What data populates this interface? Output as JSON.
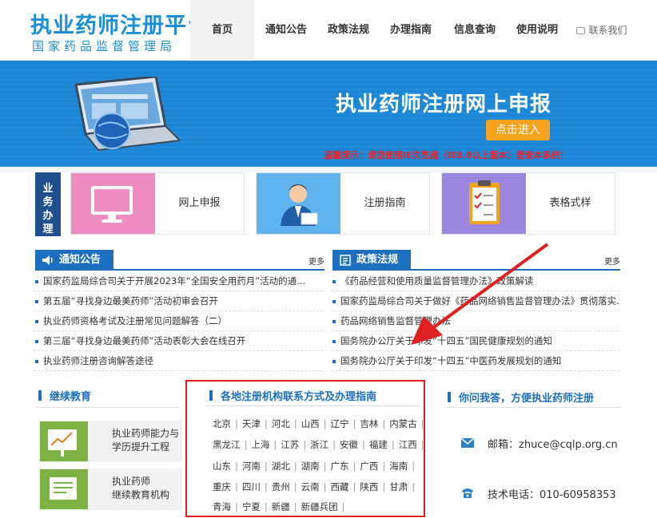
{
  "header": {
    "title": "执业药师注册平台",
    "subtitle": "国家药品监督管理局",
    "nav": [
      "首页",
      "通知公告",
      "政策法规",
      "办理指南",
      "信息查询",
      "使用说明"
    ],
    "contact": "联系我们"
  },
  "banner": {
    "title": "执业药师注册网上申报",
    "button": "点击进入",
    "tip": "温馨提示：请您使用IE浏览器（IE8.0以上版本）登录本系统！"
  },
  "business": {
    "label": [
      "业",
      "务",
      "办",
      "理"
    ],
    "cards": [
      "网上申报",
      "注册指南",
      "表格式样"
    ]
  },
  "notices": {
    "title": "通知公告",
    "more": "更多",
    "items": [
      "国家药监局综合司关于开展2023年“全国安全用药月”活动的通...",
      "第五届“寻找身边最美药师”活动初审会召开",
      "执业药师资格考试及注册常见问题解答（二）",
      "第三届“寻找身边最美药师”活动表彰大会在线召开",
      "执业药师注册咨询解答途径"
    ]
  },
  "policies": {
    "title": "政策法规",
    "more": "更多",
    "items": [
      "《药品经营和使用质量监督管理办法》政策解读",
      "国家药监局综合司关于做好《药品网络销售监督管理办法》贯彻落实...",
      "药品网络销售监督管理办法",
      "国务院办公厅关于印发“十四五”国民健康规划的通知",
      "国务院办公厅关于印发“十四五”中医药发展规划的通知"
    ]
  },
  "education": {
    "title": "继续教育",
    "items": [
      {
        "line1": "执业药师能力与",
        "line2": "学历提升工程"
      },
      {
        "line1": "执业药师",
        "line2": "继续教育机构"
      }
    ]
  },
  "provinces": {
    "title": "各地注册机构联系方式及办理指南",
    "rows": [
      [
        "北京",
        "天津",
        "河北",
        "山西",
        "辽宁",
        "吉林",
        "内蒙古"
      ],
      [
        "黑龙江",
        "上海",
        "江苏",
        "浙江",
        "安徽",
        "福建",
        "江西"
      ],
      [
        "山东",
        "河南",
        "湖北",
        "湖南",
        "广东",
        "广西",
        "海南"
      ],
      [
        "重庆",
        "四川",
        "贵州",
        "云南",
        "西藏",
        "陕西",
        "甘肃"
      ],
      [
        "青海",
        "宁夏",
        "新疆",
        "新疆兵团"
      ]
    ]
  },
  "qa": {
    "title": "你问我答，方便执业药师注册",
    "email": "邮箱：zhuce@cqlp.org.cn",
    "phone": "技术电话：010-60958353"
  },
  "colors": {
    "brand": "#1a8fd8",
    "nav_blue": "#1d6fbf",
    "banner": "#1b86d6",
    "button": "#f6a21c",
    "highlight": "#e02020"
  }
}
